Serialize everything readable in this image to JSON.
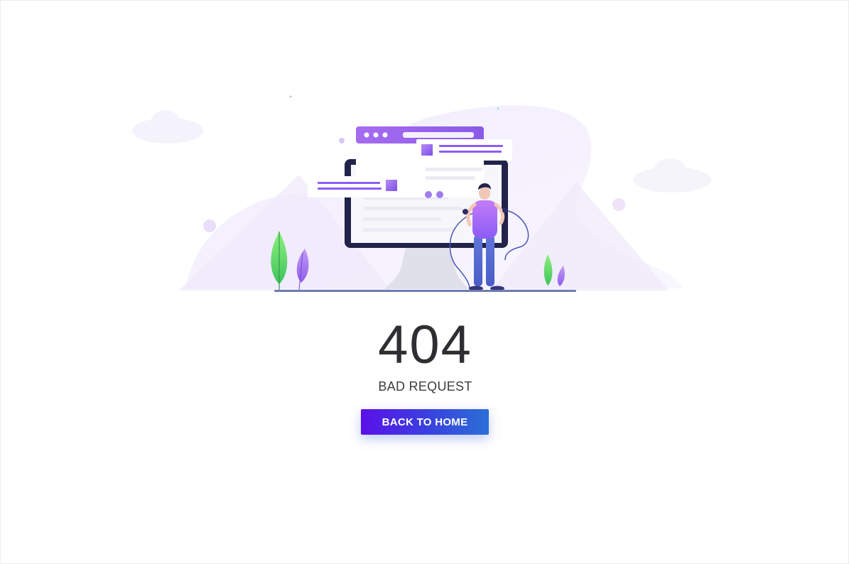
{
  "error": {
    "code": "404",
    "message": "BAD REQUEST"
  },
  "actions": {
    "home_label": "BACK TO HOME"
  },
  "colors": {
    "button_gradient_start": "#5b10e8",
    "button_gradient_end": "#2a6fd6",
    "illustration_purple": "#9b6bf0",
    "plant_green": "#5fd86a",
    "monitor_frame": "#22234a"
  },
  "illustration": {
    "subject": "person-with-computer-icon"
  }
}
